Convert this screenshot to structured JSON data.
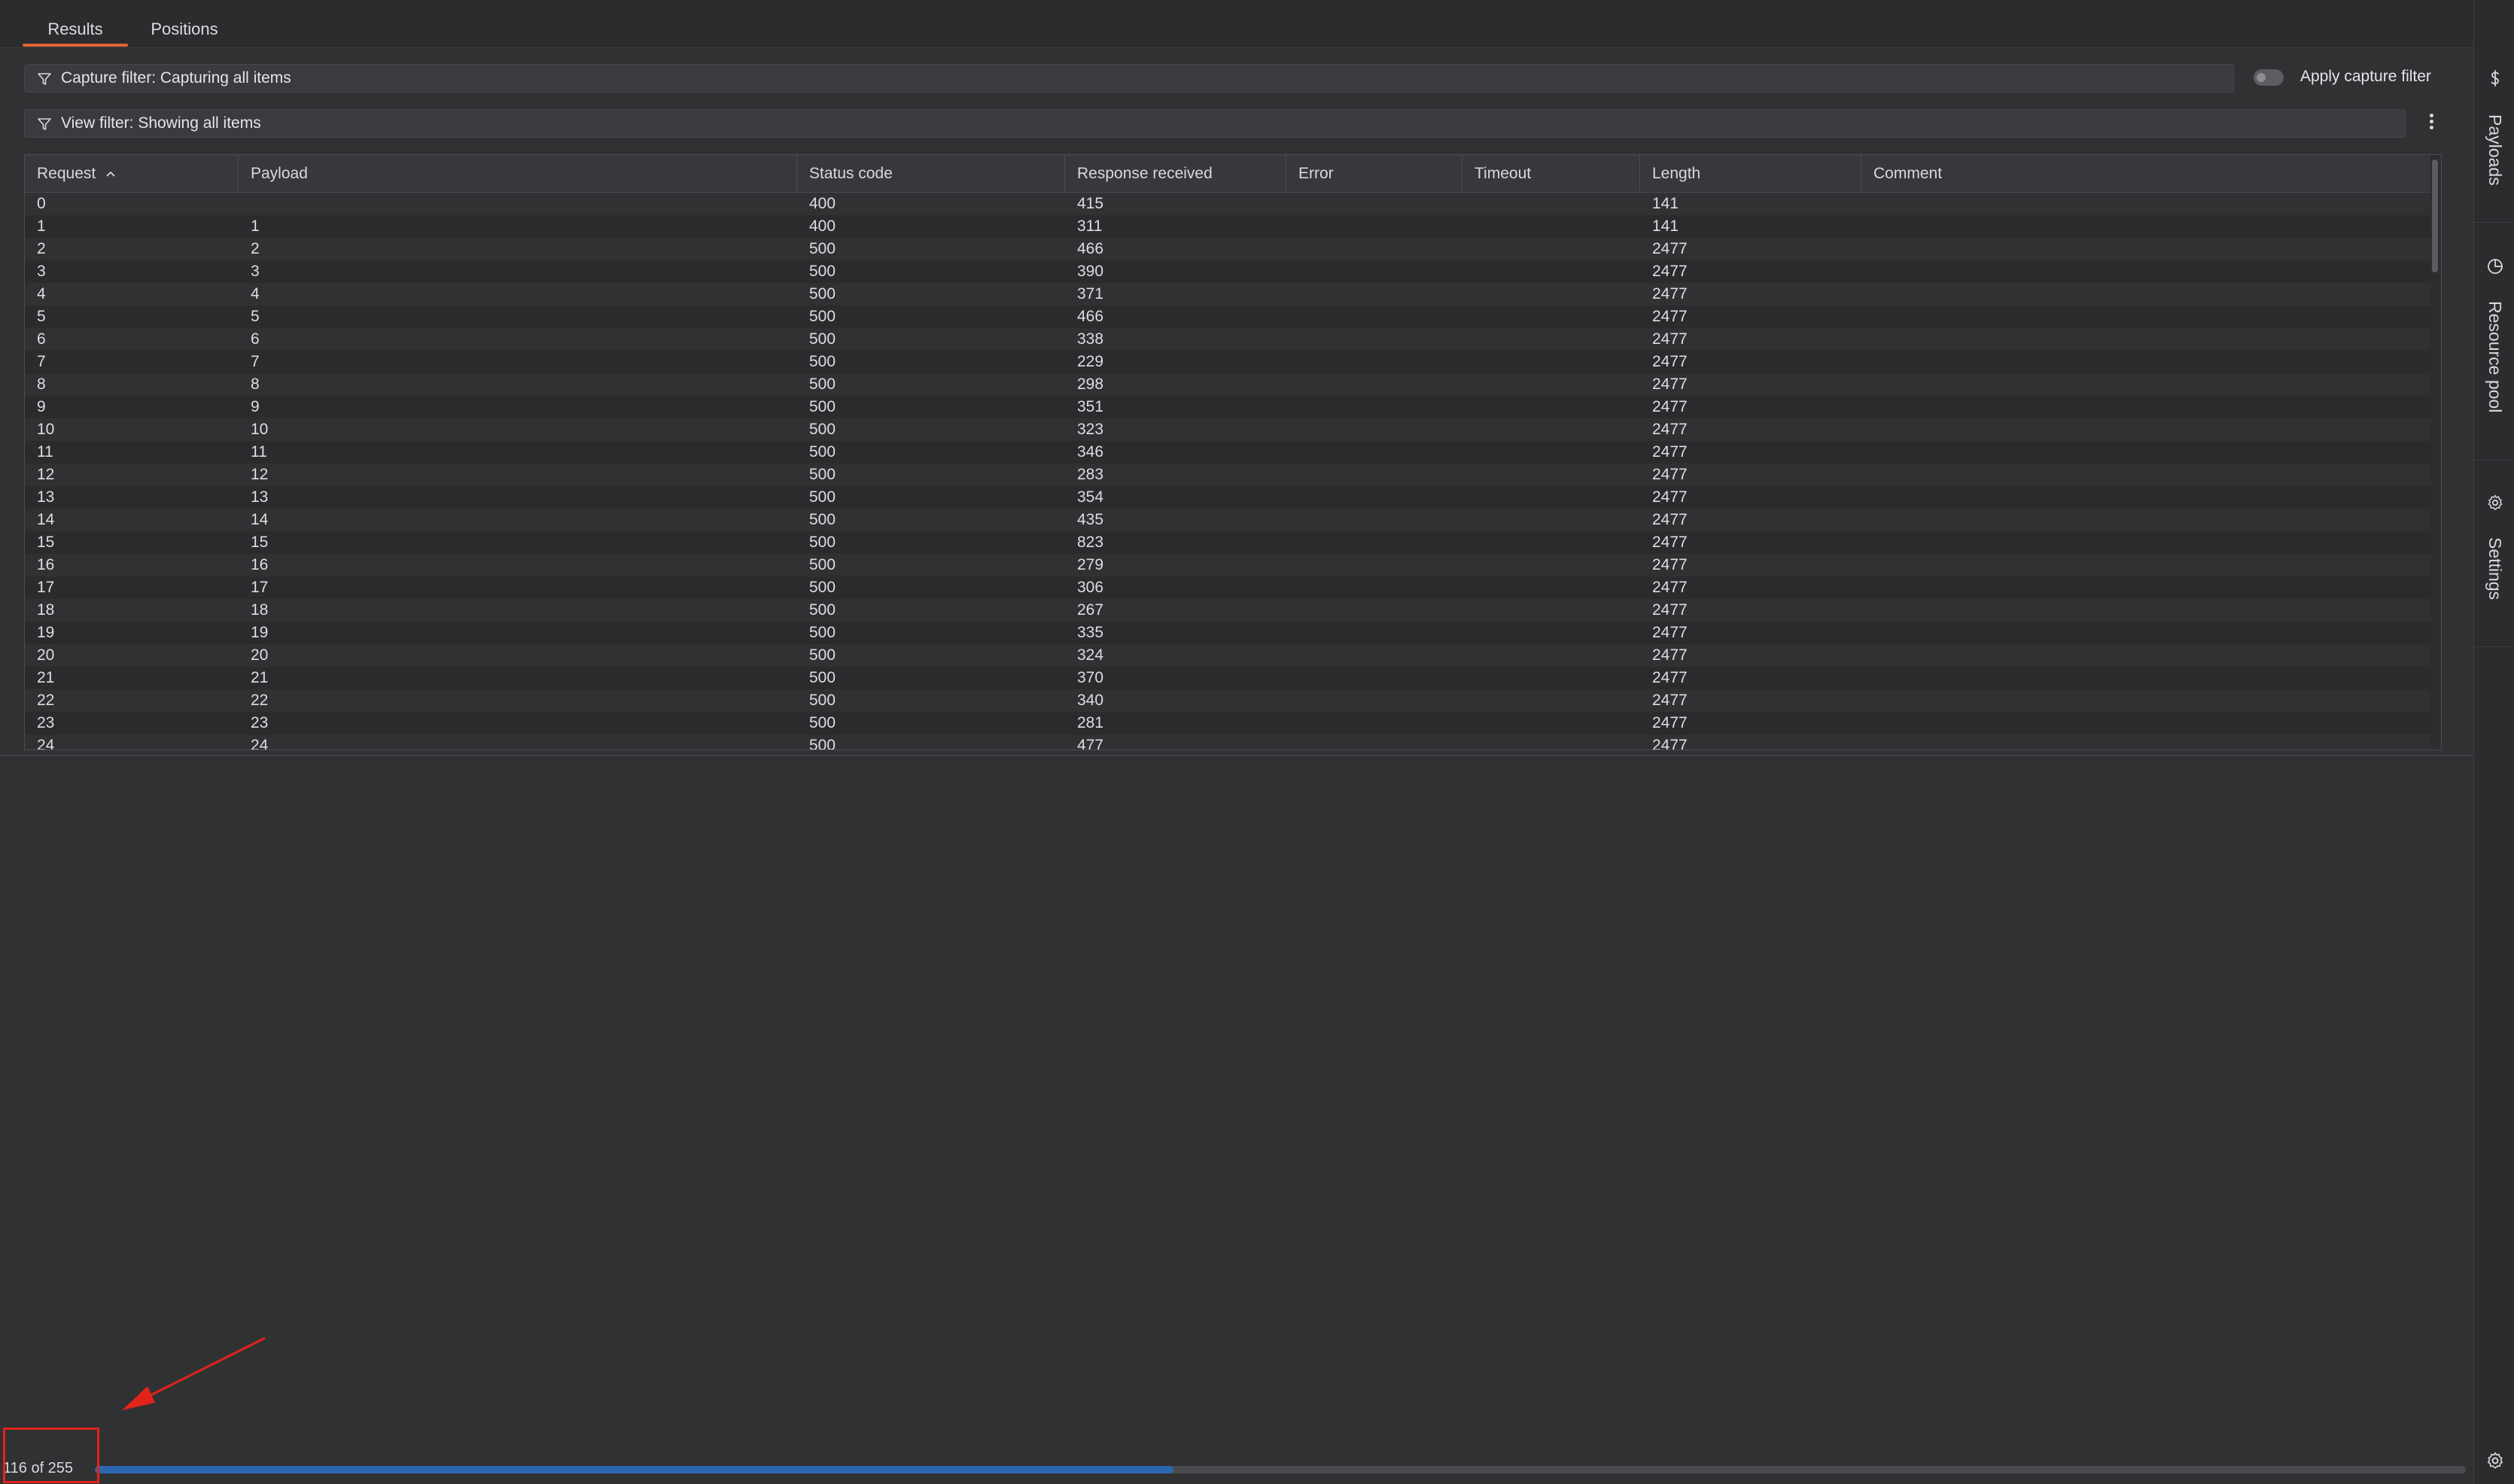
{
  "tabs": [
    {
      "label": "Results",
      "active": true
    },
    {
      "label": "Positions",
      "active": false
    }
  ],
  "capture_filter": {
    "label": "Capture filter: Capturing all items"
  },
  "apply_capture_filter": {
    "label": "Apply capture filter",
    "enabled": false
  },
  "view_filter": {
    "label": "View filter: Showing all items"
  },
  "table": {
    "columns": [
      "Request",
      "Payload",
      "Status code",
      "Response received",
      "Error",
      "Timeout",
      "Length",
      "Comment"
    ],
    "sorted_column": "Request",
    "rows": [
      [
        "0",
        "",
        "400",
        "415",
        "",
        "",
        "141",
        ""
      ],
      [
        "1",
        "1",
        "400",
        "311",
        "",
        "",
        "141",
        ""
      ],
      [
        "2",
        "2",
        "500",
        "466",
        "",
        "",
        "2477",
        ""
      ],
      [
        "3",
        "3",
        "500",
        "390",
        "",
        "",
        "2477",
        ""
      ],
      [
        "4",
        "4",
        "500",
        "371",
        "",
        "",
        "2477",
        ""
      ],
      [
        "5",
        "5",
        "500",
        "466",
        "",
        "",
        "2477",
        ""
      ],
      [
        "6",
        "6",
        "500",
        "338",
        "",
        "",
        "2477",
        ""
      ],
      [
        "7",
        "7",
        "500",
        "229",
        "",
        "",
        "2477",
        ""
      ],
      [
        "8",
        "8",
        "500",
        "298",
        "",
        "",
        "2477",
        ""
      ],
      [
        "9",
        "9",
        "500",
        "351",
        "",
        "",
        "2477",
        ""
      ],
      [
        "10",
        "10",
        "500",
        "323",
        "",
        "",
        "2477",
        ""
      ],
      [
        "11",
        "11",
        "500",
        "346",
        "",
        "",
        "2477",
        ""
      ],
      [
        "12",
        "12",
        "500",
        "283",
        "",
        "",
        "2477",
        ""
      ],
      [
        "13",
        "13",
        "500",
        "354",
        "",
        "",
        "2477",
        ""
      ],
      [
        "14",
        "14",
        "500",
        "435",
        "",
        "",
        "2477",
        ""
      ],
      [
        "15",
        "15",
        "500",
        "823",
        "",
        "",
        "2477",
        ""
      ],
      [
        "16",
        "16",
        "500",
        "279",
        "",
        "",
        "2477",
        ""
      ],
      [
        "17",
        "17",
        "500",
        "306",
        "",
        "",
        "2477",
        ""
      ],
      [
        "18",
        "18",
        "500",
        "267",
        "",
        "",
        "2477",
        ""
      ],
      [
        "19",
        "19",
        "500",
        "335",
        "",
        "",
        "2477",
        ""
      ],
      [
        "20",
        "20",
        "500",
        "324",
        "",
        "",
        "2477",
        ""
      ],
      [
        "21",
        "21",
        "500",
        "370",
        "",
        "",
        "2477",
        ""
      ],
      [
        "22",
        "22",
        "500",
        "340",
        "",
        "",
        "2477",
        ""
      ],
      [
        "23",
        "23",
        "500",
        "281",
        "",
        "",
        "2477",
        ""
      ],
      [
        "24",
        "24",
        "500",
        "477",
        "",
        "",
        "2477",
        ""
      ]
    ]
  },
  "side_panel": {
    "items": [
      {
        "label": "Payloads",
        "icon": "dollar-icon"
      },
      {
        "label": "Resource pool",
        "icon": "pie-chart-icon"
      },
      {
        "label": "Settings",
        "icon": "gear-icon"
      }
    ]
  },
  "progress": {
    "text": "116 of 255",
    "done": 116,
    "total": 255
  },
  "colors": {
    "accent": "#e06431",
    "progress": "#2d66b0",
    "annotation": "#e2231a"
  }
}
